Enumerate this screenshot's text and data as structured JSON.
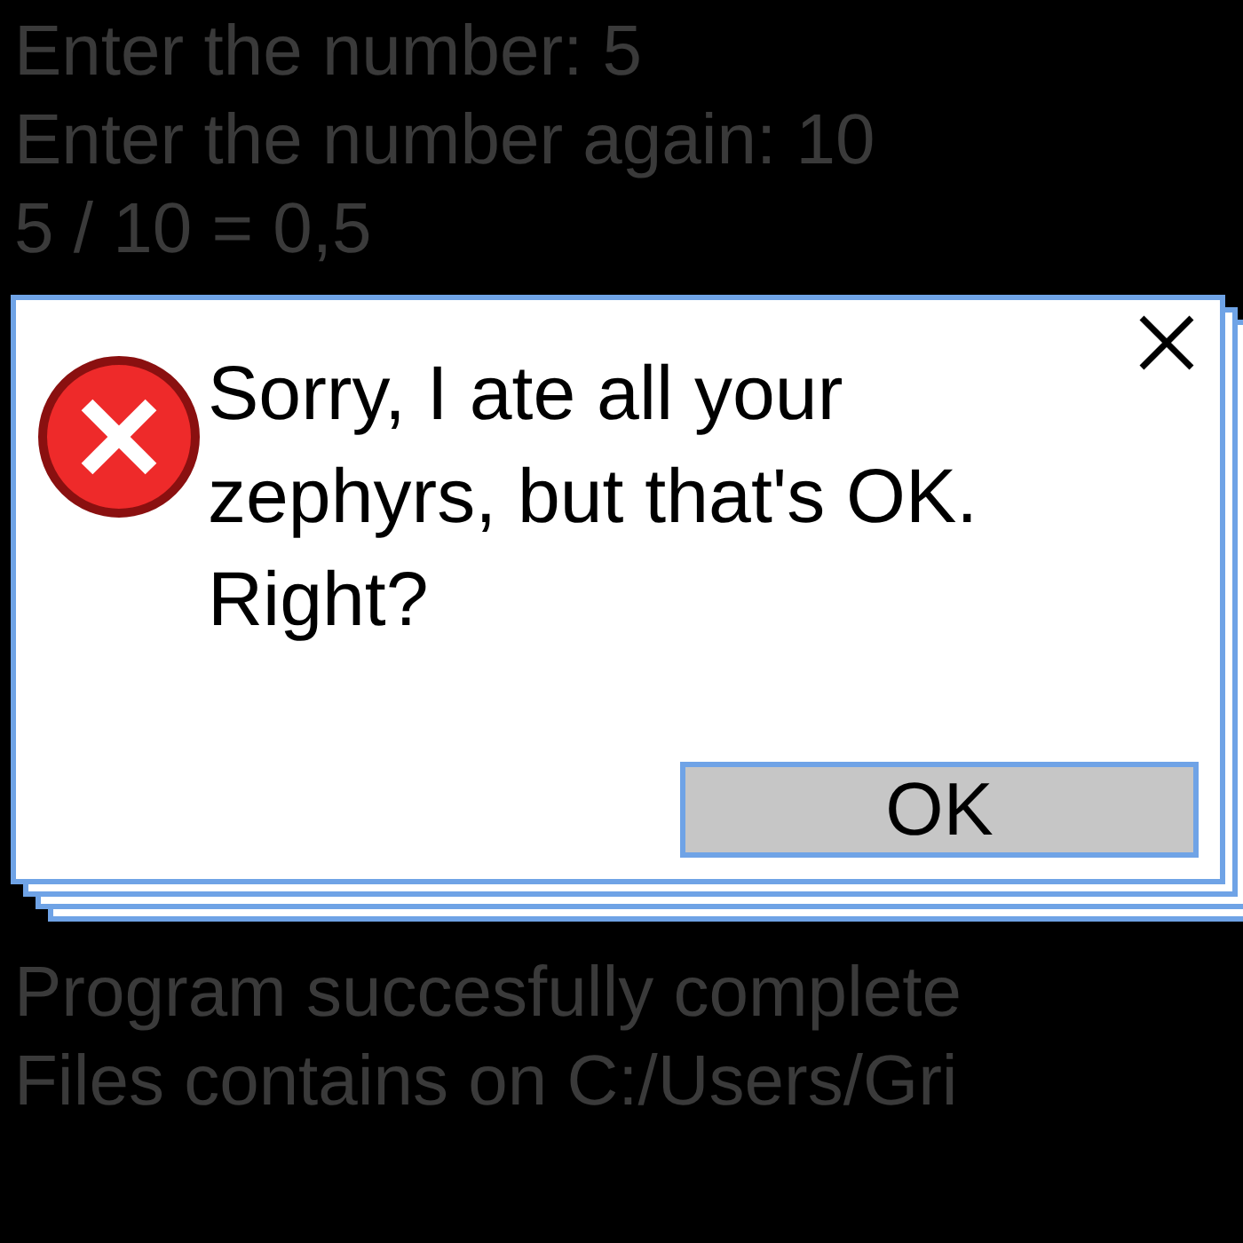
{
  "console_top": [
    "Enter the number: 5",
    "Enter the number again: 10",
    "5 / 10 = 0,5"
  ],
  "dialog": {
    "message": "Sorry, I ate all your\nzephyrs, but that's OK.\nRight?",
    "buttons": [
      {
        "label": "OK",
        "selected": true
      }
    ]
  },
  "console_bottom": [
    "Program succesfully complete",
    "Files contains on C:/Users/Gri"
  ]
}
